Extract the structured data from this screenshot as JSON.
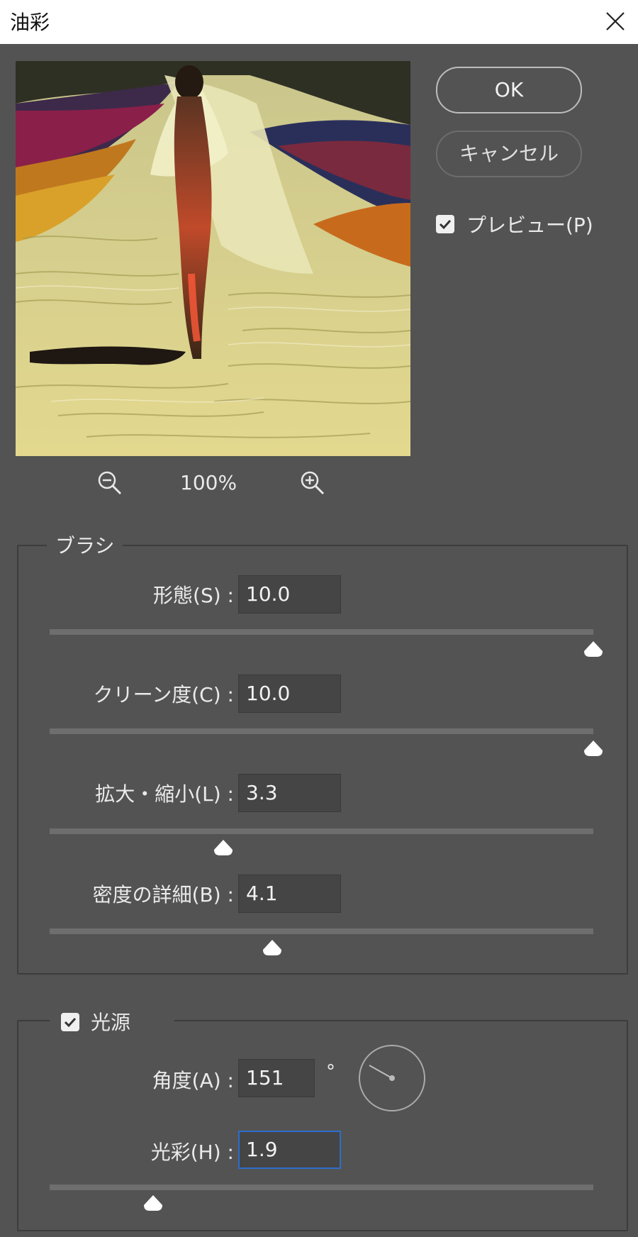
{
  "window": {
    "title": "油彩"
  },
  "buttons": {
    "ok": "OK",
    "cancel": "キャンセル"
  },
  "preview_toggle": {
    "label": "プレビュー(P)",
    "checked": true
  },
  "zoom": {
    "level": "100%"
  },
  "brush": {
    "legend": "ブラシ",
    "fields": [
      {
        "label": "形態(S) :",
        "value": "10.0",
        "slider": 1.0
      },
      {
        "label": "クリーン度(C) :",
        "value": "10.0",
        "slider": 1.0
      },
      {
        "label": "拡大・縮小(L) :",
        "value": "3.3",
        "slider": 0.32
      },
      {
        "label": "密度の詳細(B) :",
        "value": "4.1",
        "slider": 0.41
      }
    ]
  },
  "lighting": {
    "legend": "光源",
    "checked": true,
    "angle": {
      "label": "角度(A) :",
      "value": "151",
      "unit": "°"
    },
    "shine": {
      "label": "光彩(H) :",
      "value": "1.9",
      "slider": 0.19
    }
  },
  "colors": {
    "bg": "#535353",
    "focus": "#2d6ecc",
    "track": "#6e6e6e"
  }
}
